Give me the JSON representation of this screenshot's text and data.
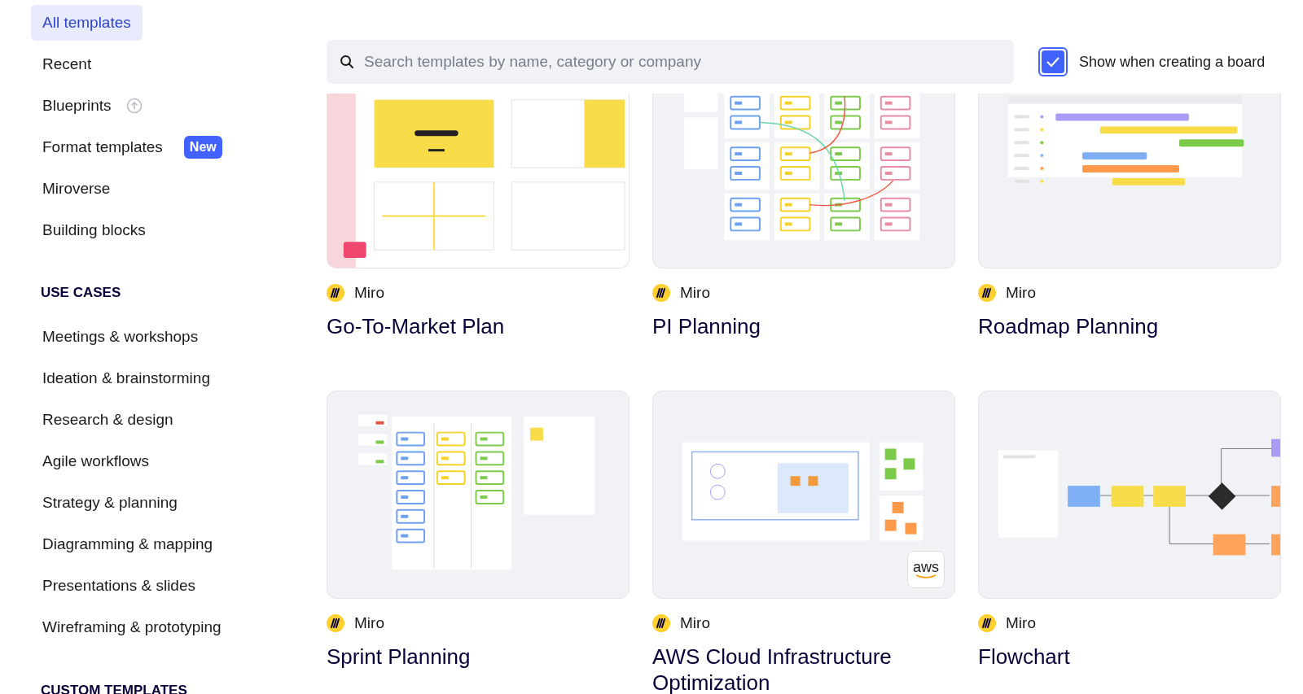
{
  "sidebar": {
    "items": [
      {
        "label": "All templates",
        "selected": true
      },
      {
        "label": "Recent",
        "selected": false
      },
      {
        "label": "Blueprints",
        "selected": false,
        "kind": "info"
      },
      {
        "label": "Format templates",
        "selected": false,
        "badge": "New"
      },
      {
        "label": "Miroverse",
        "selected": false
      },
      {
        "label": "Building blocks",
        "selected": false
      }
    ],
    "sections": [
      {
        "heading": "USE CASES",
        "items": [
          {
            "label": "Meetings & workshops",
            "selected": false
          },
          {
            "label": "Ideation & brainstorming",
            "selected": false
          },
          {
            "label": "Research & design",
            "selected": false
          },
          {
            "label": "Agile workflows",
            "selected": false
          },
          {
            "label": "Strategy & planning",
            "selected": false
          },
          {
            "label": "Diagramming & mapping",
            "selected": false
          },
          {
            "label": "Presentations & slides",
            "selected": false
          },
          {
            "label": "Wireframing & prototyping",
            "selected": false
          }
        ]
      },
      {
        "heading": "CUSTOM TEMPLATES"
      }
    ]
  },
  "search": {
    "placeholder": "Search templates by name, category or company"
  },
  "show_when_creating": {
    "label": "Show when creating a board",
    "checked": true
  },
  "templates": [
    {
      "source": "Miro",
      "title": "Go-To-Market Plan"
    },
    {
      "source": "Miro",
      "title": "PI Planning"
    },
    {
      "source": "Miro",
      "title": "Roadmap Planning"
    },
    {
      "source": "Miro",
      "title": "Sprint Planning"
    },
    {
      "source": "Miro",
      "title": "AWS Cloud Infrastructure Optimization",
      "badge": "aws"
    },
    {
      "source": "Miro",
      "title": "Flowchart"
    }
  ]
}
